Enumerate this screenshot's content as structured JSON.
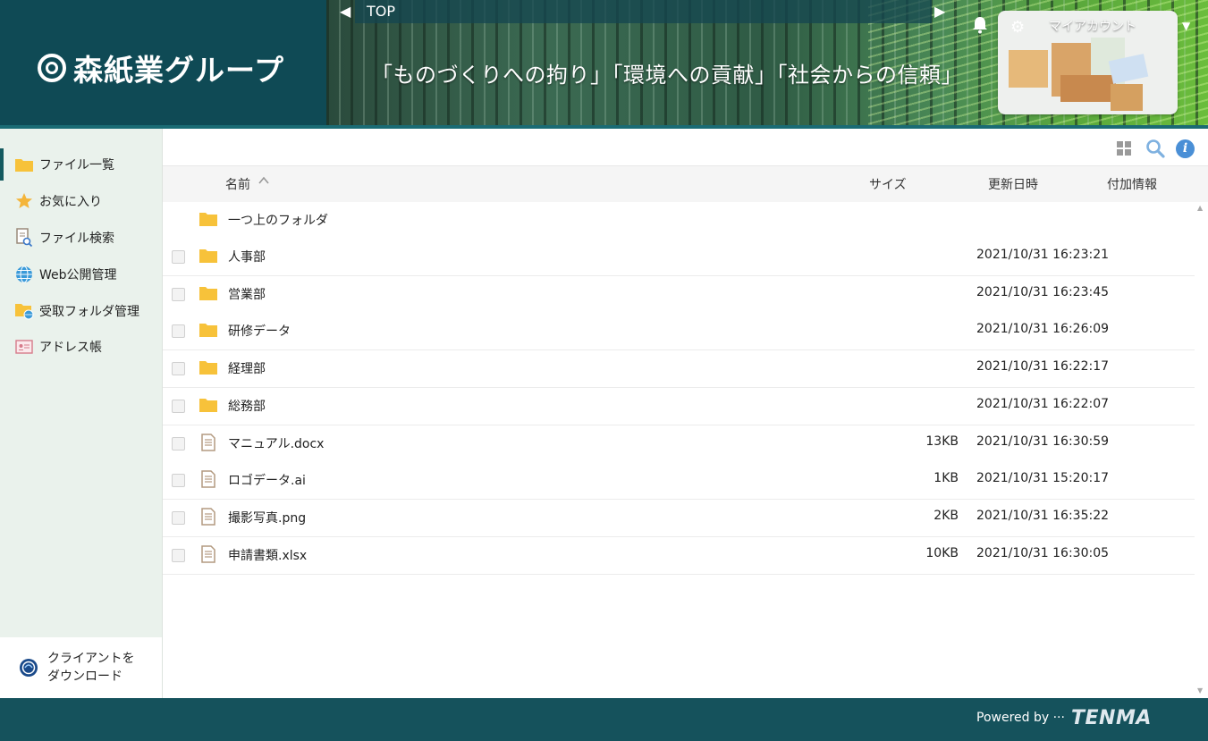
{
  "header": {
    "logo_text": "森紙業グループ",
    "slogan": "「ものづくりへの拘り」「環境への貢献」「社会からの信頼」",
    "breadcrumb_top": "TOP",
    "account_label": "マイアカウント"
  },
  "sidebar": {
    "items": [
      {
        "label": "ファイル一覧",
        "icon": "folder-icon"
      },
      {
        "label": "お気に入り",
        "icon": "star-icon"
      },
      {
        "label": "ファイル検索",
        "icon": "file-search-icon"
      },
      {
        "label": "Web公開管理",
        "icon": "globe-icon"
      },
      {
        "label": "受取フォルダ管理",
        "icon": "folder-globe-icon"
      },
      {
        "label": "アドレス帳",
        "icon": "address-card-icon"
      }
    ],
    "download_label": "クライアントを\nダウンロード"
  },
  "table": {
    "columns": {
      "name": "名前",
      "size": "サイズ",
      "date": "更新日時",
      "info": "付加情報"
    },
    "parent_folder": "一つ上のフォルダ",
    "rows": [
      {
        "name": "人事部",
        "type": "folder",
        "size": "",
        "date": "2021/10/31 16:23:21"
      },
      {
        "name": "営業部",
        "type": "folder",
        "size": "",
        "date": "2021/10/31 16:23:45"
      },
      {
        "name": "研修データ",
        "type": "folder",
        "size": "",
        "date": "2021/10/31 16:26:09"
      },
      {
        "name": "経理部",
        "type": "folder",
        "size": "",
        "date": "2021/10/31 16:22:17"
      },
      {
        "name": "総務部",
        "type": "folder",
        "size": "",
        "date": "2021/10/31 16:22:07"
      },
      {
        "name": "マニュアル.docx",
        "type": "file",
        "size": "13KB",
        "date": "2021/10/31 16:30:59"
      },
      {
        "name": "ロゴデータ.ai",
        "type": "file",
        "size": "1KB",
        "date": "2021/10/31 15:20:17"
      },
      {
        "name": "撮影写真.png",
        "type": "file",
        "size": "2KB",
        "date": "2021/10/31 16:35:22"
      },
      {
        "name": "申請書類.xlsx",
        "type": "file",
        "size": "10KB",
        "date": "2021/10/31 16:30:05"
      }
    ]
  },
  "footer": {
    "powered_by": "Powered by ···",
    "brand": "TENMA"
  },
  "colors": {
    "header_bg": "#15525c",
    "sidebar_bg": "#eaf2ec",
    "folder": "#f7c23a",
    "info": "#4a8fd6"
  }
}
